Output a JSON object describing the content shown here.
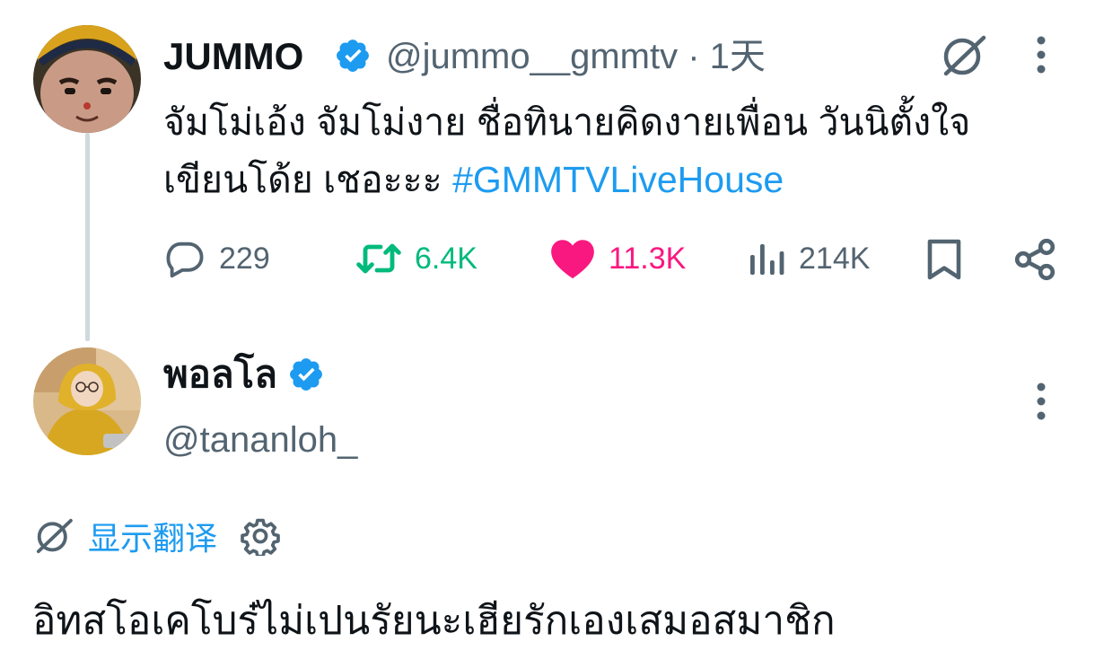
{
  "tweet": {
    "author_name": "JUMMO",
    "handle_time": "@jummo__gmmtv · 1天",
    "text": "จัมโม่เอ้ง จัมโม่งาย ชื่อทินายคิดงายเพื่อน วันนิตั้งใจเขียนโด้ย เชอะะะ ",
    "text_line1": "จัมโม่เอ้ง จัมโม่งาย ชื่อทินายคิดงายเพื่อน วันนิตั้งใจ",
    "text_line2": "เขียนโด้ย เชอะะะ ",
    "hashtag": "#GMMTVLiveHouse",
    "stats": {
      "replies": "229",
      "retweets": "6.4K",
      "likes": "11.3K",
      "views": "214K"
    }
  },
  "reply": {
    "author_name": "พอลโล",
    "handle": "@tananloh_",
    "translate_label": "显示翻译",
    "text": "อิทสโอเคโบร๋ไม่เปนรัยนะเฮียรักเองเสมอสมาชิก"
  },
  "colors": {
    "text_primary": "#0f1419",
    "text_secondary": "#536471",
    "link_blue": "#1d9bf0",
    "retweet_green": "#00ba7c",
    "like_pink": "#f91880",
    "verified_blue": "#1d9bf0",
    "thread_line": "#cfd9de"
  },
  "icons": {
    "reply": "speech-bubble-icon",
    "retweet": "retweet-icon",
    "like": "heart-icon",
    "views": "bar-chart-icon",
    "bookmark": "bookmark-icon",
    "share": "share-icon",
    "more": "vertical-dots-icon",
    "grok": "grok-slash-icon",
    "translate": "translate-slash-icon",
    "settings": "gear-icon",
    "verified": "verified-badge-icon"
  }
}
